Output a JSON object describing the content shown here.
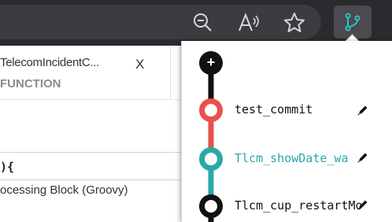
{
  "toolbar": {
    "icons": [
      "zoom-out-icon",
      "read-aloud-icon",
      "favorite-star-icon"
    ],
    "extension_icon": "git-branch-icon",
    "accent": "#2ec0c4"
  },
  "page": {
    "tab_title": "TelecomIncidentC...",
    "tab_close": "X",
    "function_label": "FUNCTION",
    "code_line": "){",
    "block_label": "ocessing Block (Groovy)"
  },
  "popup": {
    "add_button": "+",
    "commits": [
      {
        "label": "test_commit",
        "color": "#e8524a",
        "label_color": "#111111"
      },
      {
        "label": "Tlcm_showDate_wa",
        "color": "#2aa8a8",
        "label_color": "#2aa8a8"
      },
      {
        "label": "Tlcm_cup_restartMo",
        "color": "#111111",
        "label_color": "#111111"
      }
    ]
  }
}
